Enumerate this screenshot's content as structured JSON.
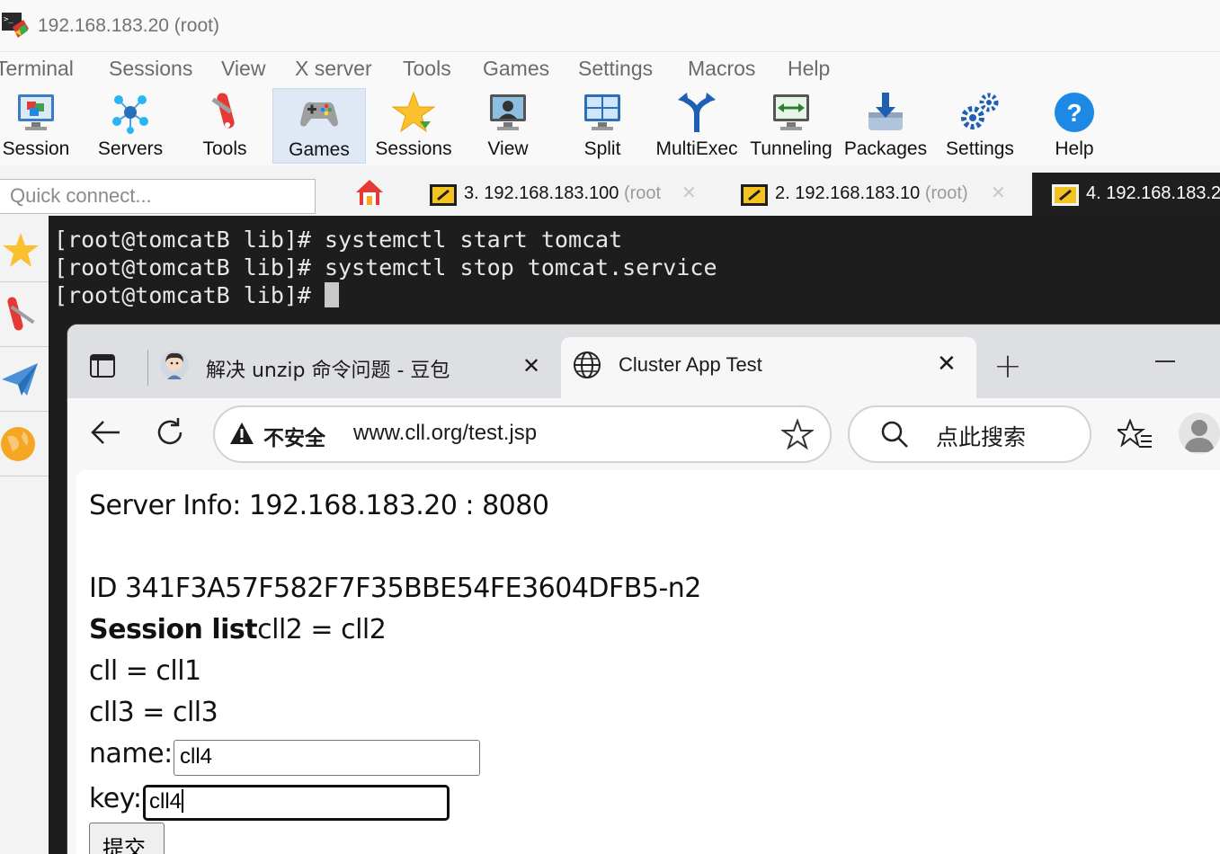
{
  "window": {
    "title": "192.168.183.20 (root)"
  },
  "menu": [
    "Terminal",
    "Sessions",
    "View",
    "X server",
    "Tools",
    "Games",
    "Settings",
    "Macros",
    "Help"
  ],
  "toolbar": [
    "Session",
    "Servers",
    "Tools",
    "Games",
    "Sessions",
    "View",
    "Split",
    "MultiExec",
    "Tunneling",
    "Packages",
    "Settings",
    "Help"
  ],
  "quick_connect": {
    "placeholder": "Quick connect..."
  },
  "session_tabs": [
    {
      "num": "3.",
      "host": "192.168.183.100",
      "user": "(root"
    },
    {
      "num": "2.",
      "host": "192.168.183.10",
      "user": "(root)"
    },
    {
      "num": "4.",
      "host": "192.168.183.2",
      "user": ""
    }
  ],
  "terminal": {
    "lines": [
      "[root@tomcatB lib]# systemctl start tomcat",
      "[root@tomcatB lib]# systemctl stop tomcat.service",
      "[root@tomcatB lib]# "
    ]
  },
  "browser": {
    "tabs": [
      {
        "label": "解决 unzip 命令问题 - 豆包"
      },
      {
        "label": "Cluster App Test"
      }
    ],
    "security": "不安全",
    "url": "www.cll.org/test.jsp",
    "search_placeholder": "点此搜索"
  },
  "page": {
    "server_info": "Server Info: 192.168.183.20 : 8080",
    "id_line": "ID 341F3A57F582F7F35BBE54FE3604DFB5-n2",
    "session_list_label": "Session list",
    "session_entries": [
      "cll2 = cll2",
      "cll = cll1",
      "cll3 = cll3"
    ],
    "name_label": "name:",
    "name_value": "cll4",
    "key_label": "key:",
    "key_value": "cll4",
    "submit_label": "提交"
  }
}
